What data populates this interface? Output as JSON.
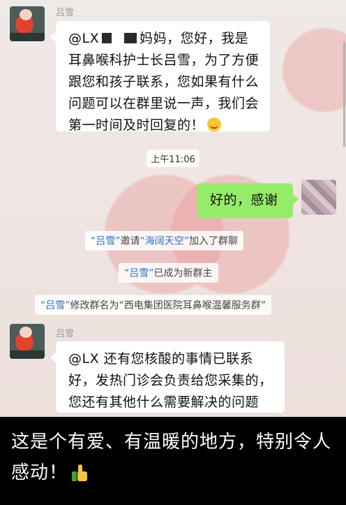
{
  "messages": [
    {
      "sender": "吕雪",
      "text_before": "@LX",
      "text_middle": "妈妈，您好，我是耳鼻喉科护士长吕雪，为了方便跟您和孩子联系，您如果有什么问题可以在群里说一声，我们会第一时间及时回复的！"
    },
    {
      "sender": "吕雪",
      "text": "@LX  还有您核酸的事情已联系好，发热门诊会负责给您采集的，您还有其他什么需要解决的问题吗？"
    }
  ],
  "timestamp": "上午11:06",
  "reply": "好的，感谢",
  "system": [
    {
      "q1": "“吕雪”",
      "mid": "邀请",
      "q2": "“海阔天空”",
      "end": "加入了群聊"
    },
    {
      "q1": "“吕雪”",
      "end": "已成为新群主"
    },
    {
      "q1": "“吕雪”",
      "end": "修改群名为“西电集团医院耳鼻喉温馨服务群”"
    }
  ],
  "caption": "这是个有爱、有温暖的地方，特别令人感动！",
  "icons": {
    "emoji": "smiling-face-icon",
    "thumb": "thumbs-up-icon"
  },
  "colors": {
    "green_bubble": "#95ec69",
    "highlight": "#2f70c9"
  }
}
